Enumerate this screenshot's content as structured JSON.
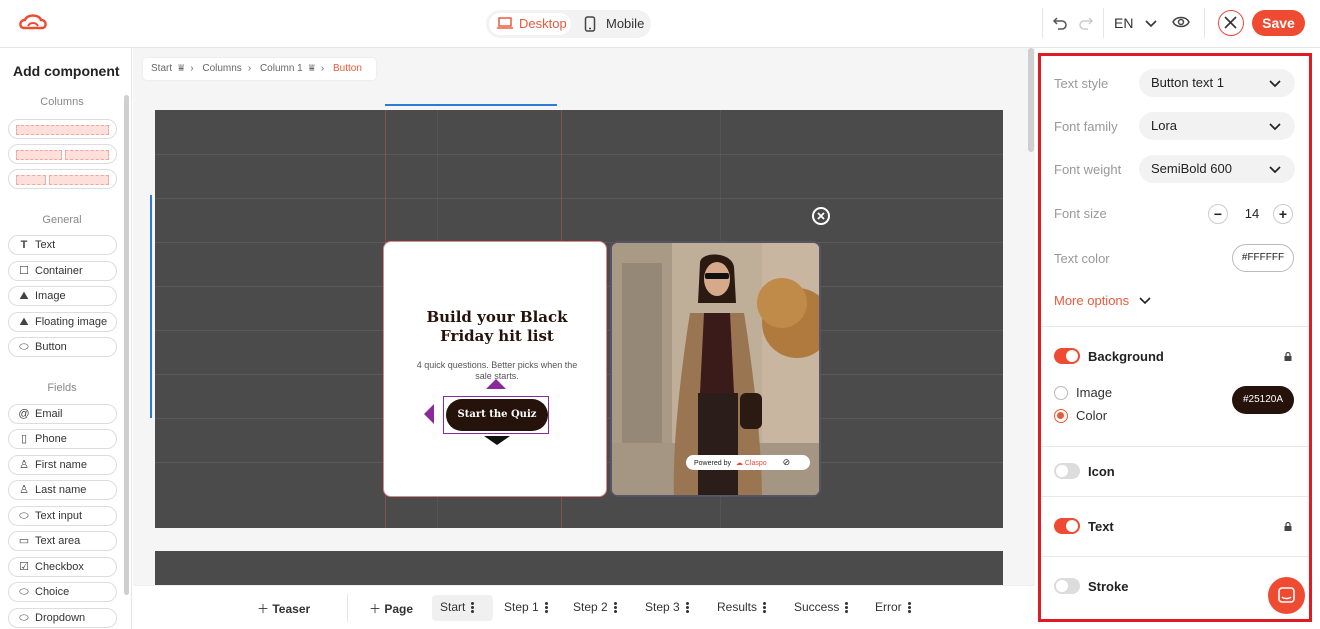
{
  "topbar": {
    "device_desktop": "Desktop",
    "device_mobile": "Mobile",
    "language": "EN",
    "save_label": "Save"
  },
  "left_panel": {
    "title": "Add component",
    "section_columns": "Columns",
    "section_general": "General",
    "section_fields": "Fields",
    "general_items": [
      {
        "label": "Text",
        "icon": "text-icon"
      },
      {
        "label": "Container",
        "icon": "container-icon"
      },
      {
        "label": "Image",
        "icon": "image-icon"
      },
      {
        "label": "Floating image",
        "icon": "floating-image-icon"
      },
      {
        "label": "Button",
        "icon": "button-icon"
      }
    ],
    "field_items": [
      {
        "label": "Email",
        "icon": "at-icon"
      },
      {
        "label": "Phone",
        "icon": "phone-icon"
      },
      {
        "label": "First name",
        "icon": "person-icon"
      },
      {
        "label": "Last name",
        "icon": "person-icon"
      },
      {
        "label": "Text input",
        "icon": "input-icon"
      },
      {
        "label": "Text area",
        "icon": "textarea-icon"
      },
      {
        "label": "Checkbox",
        "icon": "checkbox-icon"
      },
      {
        "label": "Choice",
        "icon": "choice-icon"
      },
      {
        "label": "Dropdown",
        "icon": "dropdown-icon"
      }
    ]
  },
  "breadcrumb": {
    "items": [
      "Start",
      "Columns",
      "Column 1",
      "Button"
    ]
  },
  "popup": {
    "title": "Build your Black Friday hit list",
    "subtitle": "4 quick questions. Better picks when the sale starts.",
    "button_label": "Start the Quiz",
    "powered_by": "Powered by",
    "brand": "Claspo"
  },
  "bottom_bar": {
    "teaser": "Teaser",
    "page": "Page",
    "steps": [
      "Start",
      "Step 1",
      "Step 2",
      "Step 3",
      "Results",
      "Success",
      "Error"
    ]
  },
  "right_panel": {
    "text_style_label": "Text style",
    "text_style_value": "Button text 1",
    "font_family_label": "Font family",
    "font_family_value": "Lora",
    "font_weight_label": "Font weight",
    "font_weight_value": "SemiBold 600",
    "font_size_label": "Font size",
    "font_size_value": "14",
    "text_color_label": "Text color",
    "text_color_value": "#FFFFFF",
    "more_options": "More options",
    "background_label": "Background",
    "background_on": true,
    "bg_option_image": "Image",
    "bg_option_color": "Color",
    "bg_color_value": "#25120A",
    "icon_label": "Icon",
    "icon_on": false,
    "text_label": "Text",
    "text_on": true,
    "stroke_label": "Stroke",
    "stroke_on": false
  },
  "colors": {
    "accent": "#ef4a32",
    "canvas_dark": "#4b4b4b",
    "button_bg": "#25120a",
    "guide_purple": "#8a2a9a",
    "selection_blue": "#2a7bd8"
  }
}
